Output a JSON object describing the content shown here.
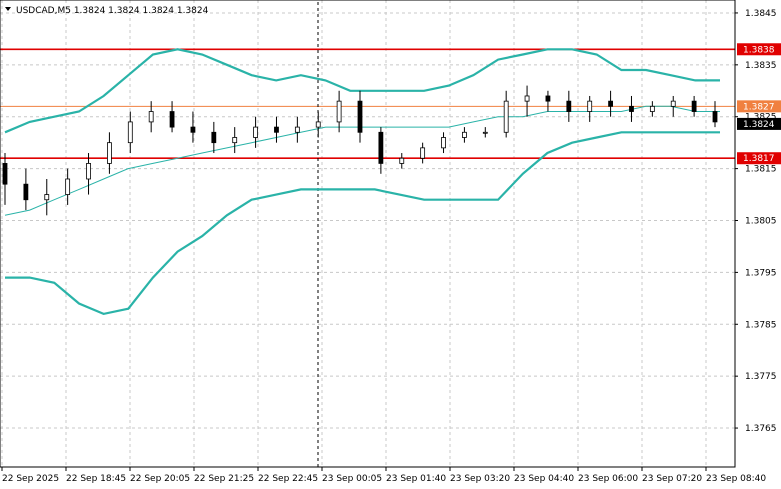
{
  "header": {
    "symbol_info": "USDCAD,M5  1.3824 1.3824 1.3824 1.3824",
    "menu_icon": "triangle-down-icon"
  },
  "chart_data": {
    "type": "candlestick",
    "symbol": "USDCAD",
    "timeframe": "M5",
    "ohlc_header": [
      1.3824,
      1.3824,
      1.3824,
      1.3824
    ],
    "ylim": [
      1.376,
      1.385
    ],
    "y_ticks": [
      "1.3845",
      "1.3835",
      "1.3825",
      "1.3815",
      "1.3805",
      "1.3795",
      "1.3785",
      "1.3775",
      "1.3765"
    ],
    "x_ticks": [
      "22 Sep 2025",
      "22 Sep 18:45",
      "22 Sep 20:05",
      "22 Sep 21:25",
      "22 Sep 22:45",
      "23 Sep 00:05",
      "23 Sep 01:40",
      "23 Sep 03:20",
      "23 Sep 04:40",
      "23 Sep 06:00",
      "23 Sep 07:20",
      "23 Sep 08:40"
    ],
    "grid": true,
    "levels": [
      {
        "label": "1.3838",
        "value": 1.3838,
        "color": "#e00000"
      },
      {
        "label": "1.3827",
        "value": 1.3827,
        "color": "#f08040"
      },
      {
        "label": "1.3817",
        "value": 1.3817,
        "color": "#e00000"
      }
    ],
    "current_price": {
      "label": "1.3824",
      "value": 1.3824
    },
    "series": [
      {
        "name": "upper_band",
        "color": "#2ab3a8",
        "values": [
          1.3822,
          1.3824,
          1.3825,
          1.3826,
          1.3829,
          1.3833,
          1.3837,
          1.3838,
          1.3837,
          1.3835,
          1.3833,
          1.3832,
          1.3833,
          1.3832,
          1.383,
          1.383,
          1.383,
          1.383,
          1.3831,
          1.3833,
          1.3836,
          1.3837,
          1.3838,
          1.3838,
          1.3837,
          1.3834,
          1.3834,
          1.3833,
          1.3832,
          1.3832
        ]
      },
      {
        "name": "middle_band",
        "color": "#2ab3a8",
        "values": [
          1.3806,
          1.3807,
          1.3809,
          1.3811,
          1.3813,
          1.3815,
          1.3816,
          1.3817,
          1.3818,
          1.3819,
          1.382,
          1.3821,
          1.3822,
          1.3823,
          1.3823,
          1.3823,
          1.3823,
          1.3823,
          1.3823,
          1.3824,
          1.3825,
          1.3825,
          1.3826,
          1.3826,
          1.3826,
          1.3826,
          1.3827,
          1.3827,
          1.3826,
          1.3826
        ]
      },
      {
        "name": "lower_band",
        "color": "#2ab3a8",
        "values": [
          1.3794,
          1.3794,
          1.3793,
          1.3789,
          1.3787,
          1.3788,
          1.3794,
          1.3799,
          1.3802,
          1.3806,
          1.3809,
          1.381,
          1.3811,
          1.3811,
          1.3811,
          1.3811,
          1.381,
          1.3809,
          1.3809,
          1.3809,
          1.3809,
          1.3814,
          1.3818,
          1.382,
          1.3821,
          1.3822,
          1.3822,
          1.3822,
          1.3822,
          1.3822
        ]
      }
    ],
    "candles": [
      [
        1.3816,
        1.3818,
        1.3808,
        1.3812
      ],
      [
        1.3812,
        1.3815,
        1.3807,
        1.3809
      ],
      [
        1.3809,
        1.3813,
        1.3806,
        1.381
      ],
      [
        1.381,
        1.3815,
        1.3808,
        1.3813
      ],
      [
        1.3813,
        1.3818,
        1.381,
        1.3816
      ],
      [
        1.3816,
        1.3822,
        1.3814,
        1.382
      ],
      [
        1.382,
        1.3826,
        1.3818,
        1.3824
      ],
      [
        1.3824,
        1.3828,
        1.3822,
        1.3826
      ],
      [
        1.3826,
        1.3828,
        1.3822,
        1.3823
      ],
      [
        1.3823,
        1.3826,
        1.382,
        1.3822
      ],
      [
        1.3822,
        1.3824,
        1.3818,
        1.382
      ],
      [
        1.382,
        1.3823,
        1.3818,
        1.3821
      ],
      [
        1.3821,
        1.3825,
        1.3819,
        1.3823
      ],
      [
        1.3823,
        1.3825,
        1.382,
        1.3822
      ],
      [
        1.3822,
        1.3825,
        1.382,
        1.3823
      ],
      [
        1.3823,
        1.3826,
        1.3821,
        1.3824
      ],
      [
        1.3824,
        1.383,
        1.3822,
        1.3828
      ],
      [
        1.3828,
        1.383,
        1.382,
        1.3822
      ],
      [
        1.3822,
        1.3823,
        1.3814,
        1.3816
      ],
      [
        1.3816,
        1.3818,
        1.3815,
        1.3817
      ],
      [
        1.3817,
        1.382,
        1.3816,
        1.3819
      ],
      [
        1.3819,
        1.3822,
        1.3818,
        1.3821
      ],
      [
        1.3821,
        1.3823,
        1.382,
        1.3822
      ],
      [
        1.3822,
        1.3823,
        1.3821,
        1.3822
      ],
      [
        1.3822,
        1.383,
        1.3821,
        1.3828
      ],
      [
        1.3828,
        1.3831,
        1.3825,
        1.3829
      ],
      [
        1.3829,
        1.383,
        1.3826,
        1.3828
      ],
      [
        1.3828,
        1.383,
        1.3824,
        1.3826
      ],
      [
        1.3826,
        1.3829,
        1.3824,
        1.3828
      ],
      [
        1.3828,
        1.383,
        1.3825,
        1.3827
      ],
      [
        1.3827,
        1.3829,
        1.3824,
        1.3826
      ],
      [
        1.3826,
        1.3828,
        1.3825,
        1.3827
      ],
      [
        1.3827,
        1.3829,
        1.3825,
        1.3828
      ],
      [
        1.3828,
        1.3829,
        1.3825,
        1.3826
      ],
      [
        1.3826,
        1.3828,
        1.3823,
        1.3824
      ]
    ]
  }
}
